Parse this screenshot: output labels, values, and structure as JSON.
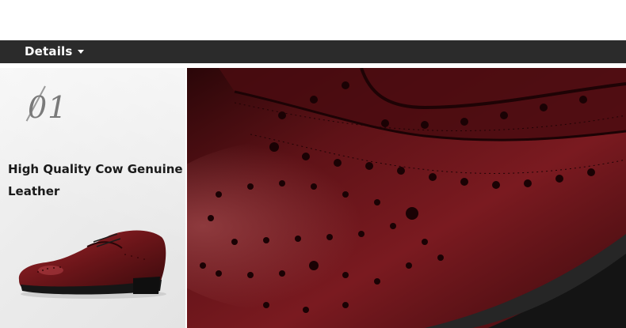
{
  "header": {
    "title": "Details"
  },
  "feature": {
    "number": "01",
    "title": "High Quality Cow Genuine Leather"
  },
  "colors": {
    "header_bar": "#2b2b2b",
    "leather": "#6b1519",
    "panel": "#ececec"
  },
  "icons": {
    "dropdown": "caret-down-icon"
  }
}
